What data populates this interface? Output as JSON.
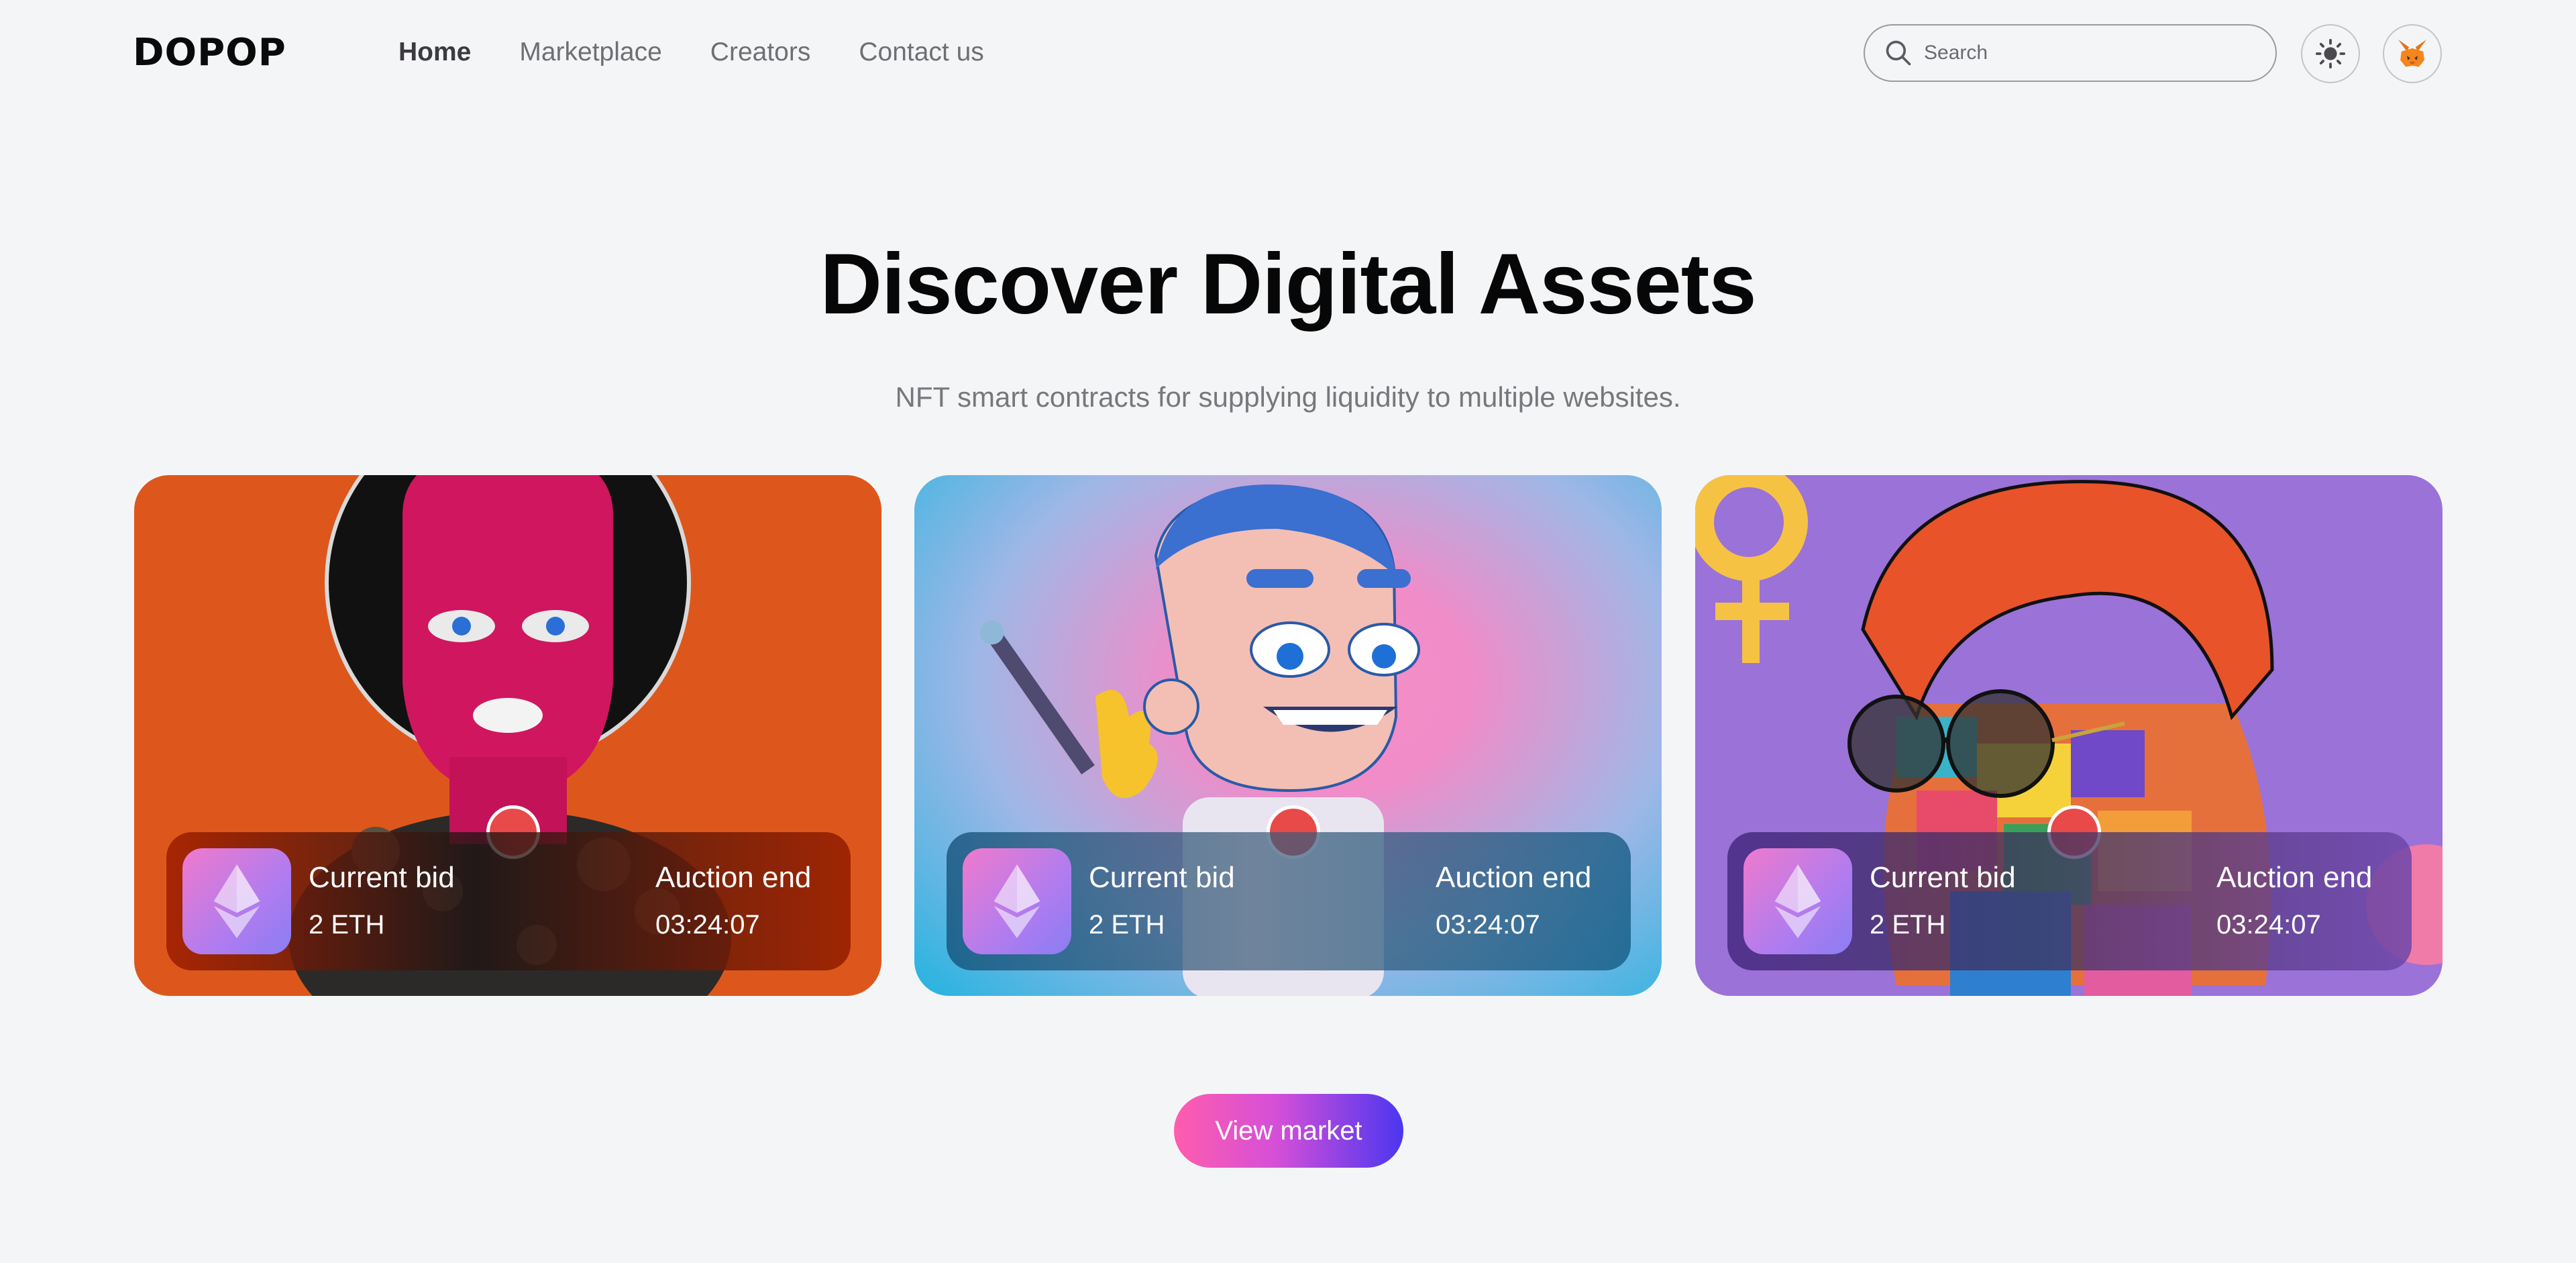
{
  "brand": {
    "logo": "DOPOP"
  },
  "nav": {
    "items": [
      {
        "label": "Home",
        "active": true
      },
      {
        "label": "Marketplace",
        "active": false
      },
      {
        "label": "Creators",
        "active": false
      },
      {
        "label": "Contact us",
        "active": false
      }
    ]
  },
  "search": {
    "placeholder": "Search",
    "icon": "search-icon"
  },
  "header_actions": {
    "theme_icon": "sun-icon",
    "wallet_icon": "fox-wallet-icon"
  },
  "hero": {
    "title": "Discover Digital Assets",
    "subtitle": "NFT smart contracts for supplying liquidity to multiple websites."
  },
  "cards": [
    {
      "art": "pink-balaclava-artwork",
      "bid_label": "Current bid",
      "bid_value": "2 ETH",
      "end_label": "Auction end",
      "end_value": "03:24:07",
      "accent": "#dd571c"
    },
    {
      "art": "cartoon-character-artwork",
      "bid_label": "Current bid",
      "bid_value": "2 ETH",
      "end_label": "Auction end",
      "end_value": "03:24:07",
      "accent": "#23b4e0"
    },
    {
      "art": "pop-art-portrait-artwork",
      "bid_label": "Current bid",
      "bid_value": "2 ETH",
      "end_label": "Auction end",
      "end_value": "03:24:07",
      "accent": "#9a72d8"
    }
  ],
  "cta": {
    "label": "View market"
  },
  "colors": {
    "background": "#f4f5f7",
    "live_dot": "#e84a4a",
    "cta_start": "#ff5cad",
    "cta_end": "#4b36f0"
  }
}
